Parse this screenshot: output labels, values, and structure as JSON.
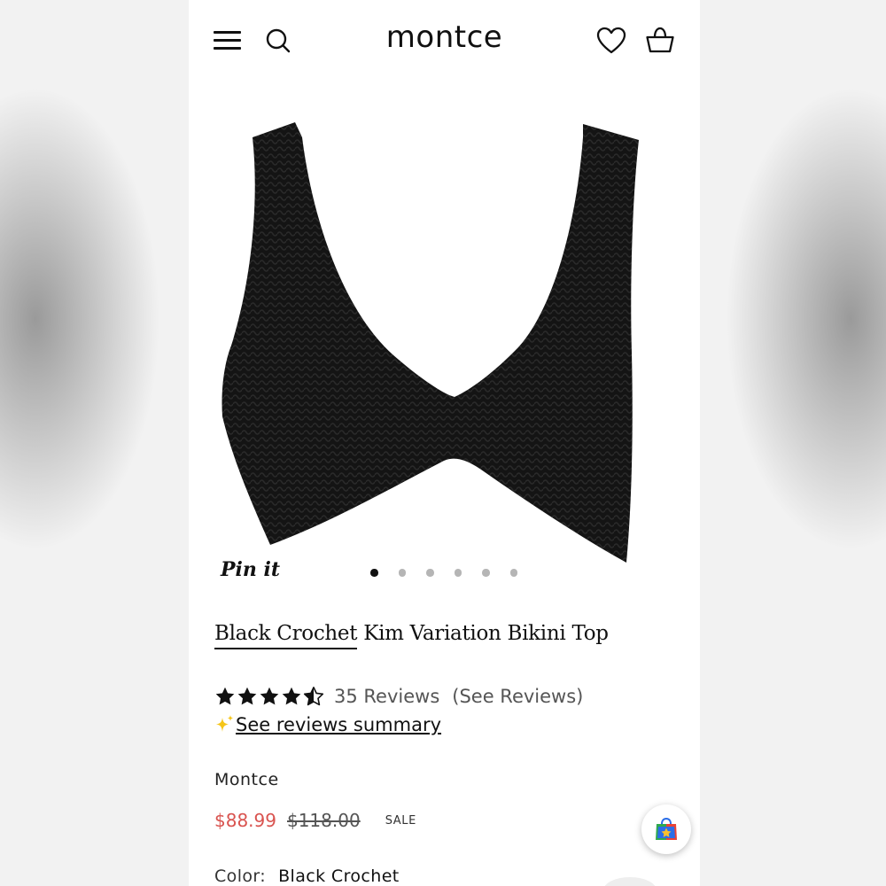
{
  "header": {
    "logo": "montce",
    "icons": {
      "menu": "hamburger-menu-icon",
      "search": "search-icon",
      "wishlist": "heart-icon",
      "cart": "basket-icon"
    }
  },
  "gallery": {
    "pin_label": "Pin it",
    "slide_count": 6,
    "active_slide": 1
  },
  "product": {
    "title_underlined": "Black Crochet",
    "title_rest": " Kim Variation Bikini Top",
    "rating": 4.5,
    "review_count": "35 Reviews",
    "see_reviews": "(See Reviews)",
    "summary_link": "See reviews summary",
    "brand": "Montce",
    "sale_price": "$88.99",
    "original_price": "$118.00",
    "sale_badge": "SALE",
    "color_label": "Color:",
    "color_value": "Black Crochet"
  },
  "colors": {
    "sale_price": "#d9534f",
    "sparkle": "#f5c518",
    "text": "#111111"
  }
}
